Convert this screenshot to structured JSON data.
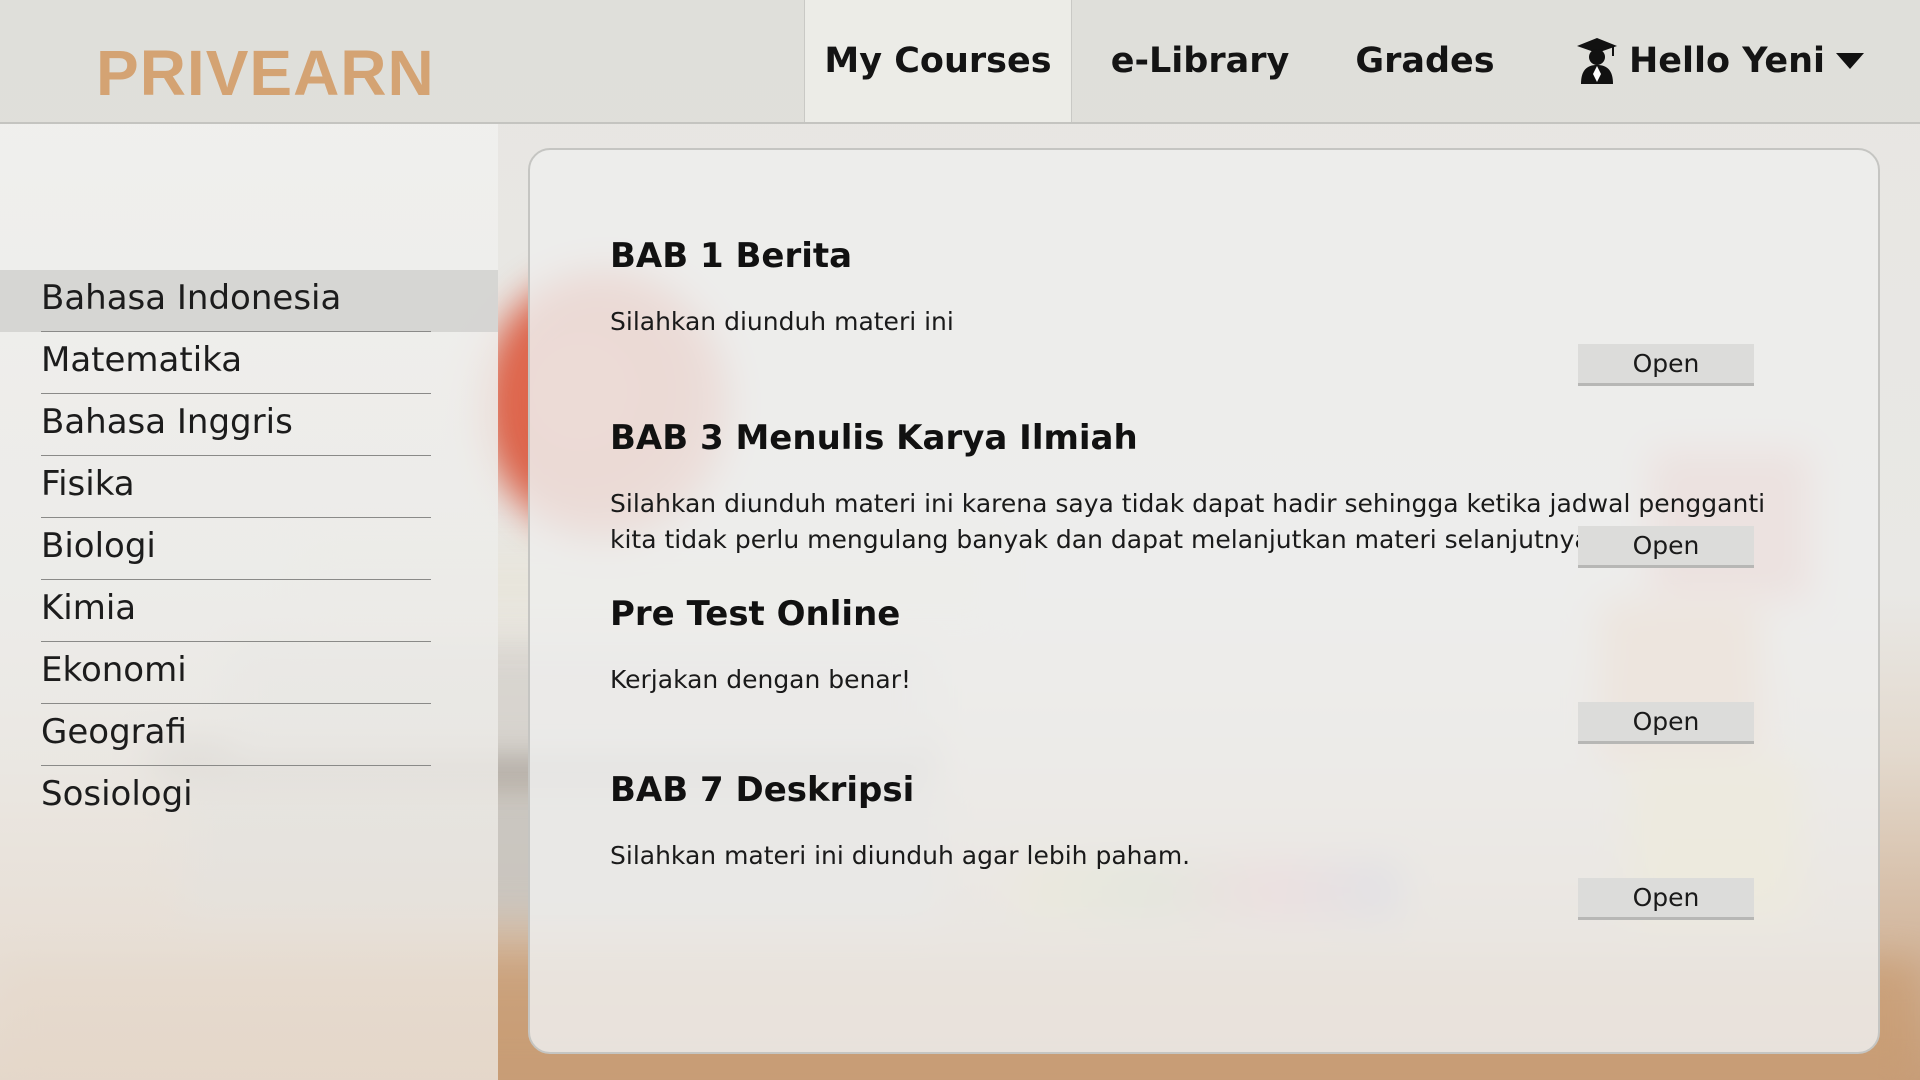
{
  "header": {
    "logo": "PRIVEARN",
    "nav": [
      {
        "label": "My Courses",
        "active": true
      },
      {
        "label": "e-Library",
        "active": false
      },
      {
        "label": "Grades",
        "active": false
      }
    ],
    "user": {
      "greeting": "Hello Yeni",
      "icon": "student-graduate-icon",
      "menu_icon": "caret-down-icon"
    }
  },
  "sidebar": {
    "items": [
      {
        "label": "Bahasa Indonesia",
        "active": true
      },
      {
        "label": "Matematika",
        "active": false
      },
      {
        "label": "Bahasa Inggris",
        "active": false
      },
      {
        "label": "Fisika",
        "active": false
      },
      {
        "label": "Biologi",
        "active": false
      },
      {
        "label": "Kimia",
        "active": false
      },
      {
        "label": "Ekonomi",
        "active": false
      },
      {
        "label": "Geografi",
        "active": false
      },
      {
        "label": "Sosiologi",
        "active": false
      }
    ]
  },
  "main": {
    "materials": [
      {
        "title": "BAB 1 Berita",
        "description": "Silahkan diunduh materi ini",
        "button": "Open"
      },
      {
        "title": "BAB 3 Menulis Karya Ilmiah",
        "description": "Silahkan diunduh materi ini karena saya tidak dapat hadir sehingga ketika jadwal pengganti kita tidak perlu mengulang banyak dan dapat melanjutkan materi selanjutnya",
        "button": "Open"
      },
      {
        "title": "Pre Test Online",
        "description": "Kerjakan dengan benar!",
        "button": "Open"
      },
      {
        "title": "BAB 7 Deskripsi",
        "description": "Silahkan materi ini diunduh agar lebih paham.",
        "button": "Open"
      }
    ]
  },
  "colors": {
    "logo": "#d4a373",
    "header_bg": "#dedfd9",
    "active_nav_bg": "#ececE8",
    "sidebar_active_bg": "#d4d4d2",
    "button_bg": "#dcdcda"
  }
}
